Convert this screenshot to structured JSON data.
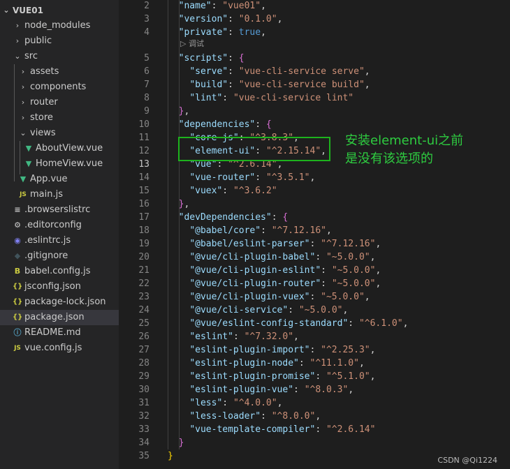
{
  "explorer": {
    "root_label": "VUE01",
    "items": [
      {
        "label": "node_modules",
        "kind": "folder-collapsed",
        "icon": "chevron-right-icon"
      },
      {
        "label": "public",
        "kind": "folder-collapsed",
        "icon": "chevron-right-icon"
      },
      {
        "label": "src",
        "kind": "folder-expanded",
        "icon": "chevron-down-icon"
      },
      {
        "label": "assets",
        "kind": "folder-collapsed",
        "icon": "chevron-right-icon"
      },
      {
        "label": "components",
        "kind": "folder-collapsed",
        "icon": "chevron-right-icon"
      },
      {
        "label": "router",
        "kind": "folder-collapsed",
        "icon": "chevron-right-icon"
      },
      {
        "label": "store",
        "kind": "folder-collapsed",
        "icon": "chevron-right-icon"
      },
      {
        "label": "views",
        "kind": "folder-expanded",
        "icon": "chevron-down-icon"
      },
      {
        "label": "AboutView.vue",
        "kind": "file",
        "icon": "vue-file-icon"
      },
      {
        "label": "HomeView.vue",
        "kind": "file",
        "icon": "vue-file-icon"
      },
      {
        "label": "App.vue",
        "kind": "file",
        "icon": "vue-file-icon"
      },
      {
        "label": "main.js",
        "kind": "file",
        "icon": "js-file-icon"
      },
      {
        "label": ".browserslistrc",
        "kind": "file",
        "icon": "browserslist-file-icon"
      },
      {
        "label": ".editorconfig",
        "kind": "file",
        "icon": "gear-file-icon"
      },
      {
        "label": ".eslintrc.js",
        "kind": "file",
        "icon": "eslint-file-icon"
      },
      {
        "label": ".gitignore",
        "kind": "file",
        "icon": "git-file-icon"
      },
      {
        "label": "babel.config.js",
        "kind": "file",
        "icon": "babel-file-icon"
      },
      {
        "label": "jsconfig.json",
        "kind": "file",
        "icon": "json-file-icon"
      },
      {
        "label": "package-lock.json",
        "kind": "file",
        "icon": "json-file-icon"
      },
      {
        "label": "package.json",
        "kind": "file",
        "icon": "json-file-icon",
        "selected": true
      },
      {
        "label": "README.md",
        "kind": "file",
        "icon": "info-file-icon"
      },
      {
        "label": "vue.config.js",
        "kind": "file",
        "icon": "js-file-icon"
      }
    ],
    "icon_glyphs": {
      "vue": "▼",
      "js": "JS",
      "browserslist": "≡",
      "gear": "⚙",
      "eslint": "◉",
      "git": "◆",
      "babel": "B",
      "json": "{}",
      "info": "ⓘ",
      "chevron_right": "›",
      "chevron_down": "⌄"
    },
    "icon_colors": {
      "vue": "#41b883",
      "js": "#cbcb41",
      "browserslist": "#cccccc",
      "gear": "#cccccc",
      "eslint": "#8080f2",
      "git": "#41535b",
      "babel": "#cbcb41",
      "json": "#cbcb41",
      "info": "#519aba"
    }
  },
  "editor": {
    "codelens_label": "▷ 调试",
    "active_line": 13,
    "lines": [
      {
        "n": 2,
        "code": "  \"name\": \"vue01\","
      },
      {
        "n": 3,
        "code": "  \"version\": \"0.1.0\","
      },
      {
        "n": 4,
        "code": "  \"private\": true,"
      },
      {
        "n": 5,
        "code": "  \"scripts\": {"
      },
      {
        "n": 6,
        "code": "    \"serve\": \"vue-cli-service serve\","
      },
      {
        "n": 7,
        "code": "    \"build\": \"vue-cli-service build\","
      },
      {
        "n": 8,
        "code": "    \"lint\": \"vue-cli-service lint\""
      },
      {
        "n": 9,
        "code": "  },"
      },
      {
        "n": 10,
        "code": "  \"dependencies\": {"
      },
      {
        "n": 11,
        "code": "    \"core-js\": \"^3.8.3\","
      },
      {
        "n": 12,
        "code": "    \"element-ui\": \"^2.15.14\","
      },
      {
        "n": 13,
        "code": "    \"vue\": \"^2.6.14\","
      },
      {
        "n": 14,
        "code": "    \"vue-router\": \"^3.5.1\","
      },
      {
        "n": 15,
        "code": "    \"vuex\": \"^3.6.2\""
      },
      {
        "n": 16,
        "code": "  },"
      },
      {
        "n": 17,
        "code": "  \"devDependencies\": {"
      },
      {
        "n": 18,
        "code": "    \"@babel/core\": \"^7.12.16\","
      },
      {
        "n": 19,
        "code": "    \"@babel/eslint-parser\": \"^7.12.16\","
      },
      {
        "n": 20,
        "code": "    \"@vue/cli-plugin-babel\": \"~5.0.0\","
      },
      {
        "n": 21,
        "code": "    \"@vue/cli-plugin-eslint\": \"~5.0.0\","
      },
      {
        "n": 22,
        "code": "    \"@vue/cli-plugin-router\": \"~5.0.0\","
      },
      {
        "n": 23,
        "code": "    \"@vue/cli-plugin-vuex\": \"~5.0.0\","
      },
      {
        "n": 24,
        "code": "    \"@vue/cli-service\": \"~5.0.0\","
      },
      {
        "n": 25,
        "code": "    \"@vue/eslint-config-standard\": \"^6.1.0\","
      },
      {
        "n": 26,
        "code": "    \"eslint\": \"^7.32.0\","
      },
      {
        "n": 27,
        "code": "    \"eslint-plugin-import\": \"^2.25.3\","
      },
      {
        "n": 28,
        "code": "    \"eslint-plugin-node\": \"^11.1.0\","
      },
      {
        "n": 29,
        "code": "    \"eslint-plugin-promise\": \"^5.1.0\","
      },
      {
        "n": 30,
        "code": "    \"eslint-plugin-vue\": \"^8.0.3\","
      },
      {
        "n": 31,
        "code": "    \"less\": \"^4.0.0\","
      },
      {
        "n": 32,
        "code": "    \"less-loader\": \"^8.0.0\","
      },
      {
        "n": 33,
        "code": "    \"vue-template-compiler\": \"^2.6.14\""
      },
      {
        "n": 34,
        "code": "  }"
      },
      {
        "n": 35,
        "code": "}"
      }
    ],
    "colors": {
      "key": "#9cdcfe",
      "string": "#ce9178",
      "boolean": "#569cd6",
      "brace_level1": "#da70d6",
      "brace_level0": "#ffd700",
      "highlight_box": "#1db31d",
      "annotation": "#2ecc40"
    }
  },
  "annotation": {
    "line1": "安装element-ui之前",
    "line2": "是没有该选项的"
  },
  "watermark": "CSDN @Qi1224"
}
